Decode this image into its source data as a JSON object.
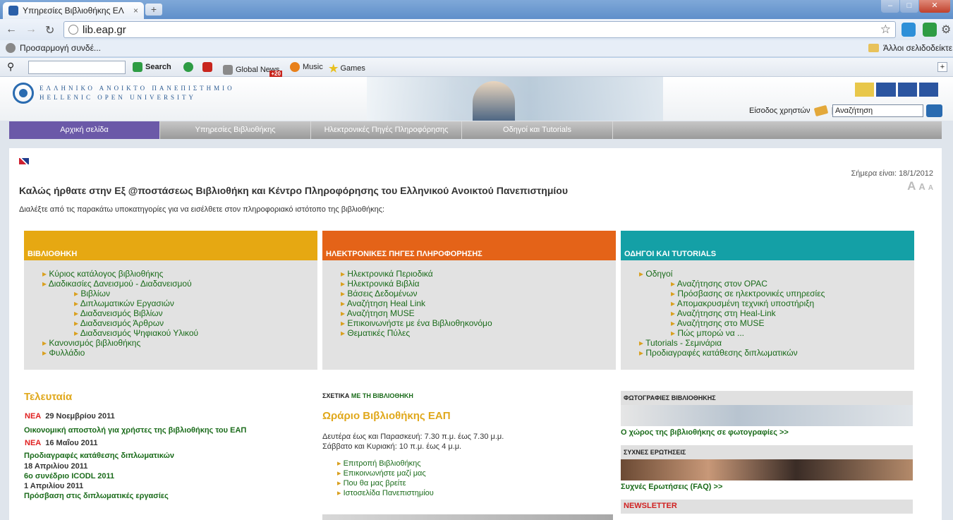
{
  "browser": {
    "tab_title": "Υπηρεσίες Βιβλιοθήκης ΕΛ",
    "url": "lib.eap.gr",
    "bookmark_customize": "Προσαρμογή συνδέ...",
    "bookmark_other": "Άλλοι σελιδοδείκτε",
    "toolbar2": {
      "search_label": "Search",
      "global_news": "Global News",
      "global_news_badge": "+20",
      "music": "Music",
      "games": "Games"
    }
  },
  "header": {
    "logo_line1": "ΕΛΛΗΝΙΚΟ ΑΝΟΙΚΤΟ ΠΑΝΕΠΙΣΤΗΜΙΟ",
    "logo_line2": "HELLENIC OPEN UNIVERSITY",
    "login": "Είσοδος χρηστών",
    "search_value": "Αναζήτηση"
  },
  "menu": [
    "Αρχική σελίδα",
    "Υπηρεσίες Βιβλιοθήκης",
    "Ηλεκτρονικές Πηγές Πληροφόρησης",
    "Οδηγοί και Tutorials"
  ],
  "today": "Σήμερα είναι: 18/1/2012",
  "welcome": "Καλώς ήρθατε στην Εξ @ποστάσεως Βιβλιοθήκη και Κέντρο Πληροφόρησης του Ελληνικού Ανοικτού Πανεπιστημίου",
  "intro": "Διαλέξτε από τις παρακάτω υποκατηγορίες για να εισέλθετε στον πληροφοριακό ιστότοπο της βιβλιοθήκης:",
  "boxes": [
    {
      "title": "ΒΙΒΛΙΟΘΗΚΗ",
      "color": "#e6a812",
      "items": [
        {
          "label": "Κύριος κατάλογος βιβλιοθήκης",
          "level": 1
        },
        {
          "label": "Διαδικασίες Δανεισμού - Διαδανεισμού",
          "level": 1
        },
        {
          "label": "Βιβλίων",
          "level": 2
        },
        {
          "label": "Διπλωματικών Εργασιών",
          "level": 2
        },
        {
          "label": "Διαδανεισμός Βιβλίων",
          "level": 2
        },
        {
          "label": "Διαδανεισμός Άρθρων",
          "level": 2
        },
        {
          "label": "Διαδανεισμός Ψηφιακού Υλικού",
          "level": 2
        },
        {
          "label": "Κανονισμός βιβλιοθήκης",
          "level": 1
        },
        {
          "label": "Φυλλάδιο",
          "level": 1
        }
      ]
    },
    {
      "title": "ΗΛΕΚΤΡΟΝΙΚΕΣ ΠΗΓΕΣ ΠΛΗΡΟΦΟΡΗΣΗΣ",
      "color": "#e46318",
      "items": [
        {
          "label": "Ηλεκτρονικά Περιοδικά",
          "level": 1
        },
        {
          "label": "Ηλεκτρονικά Βιβλία",
          "level": 1
        },
        {
          "label": "Βάσεις Δεδομένων",
          "level": 1
        },
        {
          "label": "Αναζήτηση Heal Link",
          "level": 1
        },
        {
          "label": "Αναζήτηση MUSE",
          "level": 1
        },
        {
          "label": "Επικοινωνήστε με ένα Βιβλιοθηκονόμο",
          "level": 1
        },
        {
          "label": "Θεματικές Πύλες",
          "level": 1
        }
      ]
    },
    {
      "title": "ΟΔΗΓΟΙ ΚΑΙ TUTORIALS",
      "color": "#14a0a6",
      "items": [
        {
          "label": "Οδηγοί",
          "level": 1
        },
        {
          "label": "Αναζήτησης στον OPAC",
          "level": 2
        },
        {
          "label": "Πρόσβασης σε ηλεκτρονικές υπηρεσίες",
          "level": 2
        },
        {
          "label": "Απομακρυσμένη τεχνική υποστήριξη",
          "level": 2
        },
        {
          "label": "Αναζήτησης στη Heal-Link",
          "level": 2
        },
        {
          "label": "Αναζήτησης στο MUSE",
          "level": 2
        },
        {
          "label": "Πώς μπορώ να ...",
          "level": 2
        },
        {
          "label": "Tutorials - Σεμινάρια",
          "level": 1
        },
        {
          "label": "Προδιαγραφές κατάθεσης διπλωματικών",
          "level": 1
        }
      ]
    }
  ],
  "news": {
    "title": "Τελευταία",
    "new_badge": "ΝΕΑ",
    "items": [
      {
        "date": "29 Νοεμβρίου 2011",
        "text": "Οικονομική αποστολή για χρήστες της βιβλιοθήκης του ΕΑΠ"
      },
      {
        "date": "16 Μαΐου 2011",
        "text": "Προδιαγραφές κατάθεσης διπλωματικών"
      },
      {
        "date": "18 Απριλίου 2011",
        "text": "6ο συνέδριο ICODL 2011"
      },
      {
        "date": "1 Απριλίου 2011",
        "text": "Πρόσβαση στις διπλωματικές εργασίες"
      }
    ]
  },
  "about": {
    "label_a": "ΣΧΕΤΙΚΑ",
    "label_b": "ΜΕ ΤΗ ΒΙΒΛΙΟΘΗΚΗ",
    "hours_title": "Ωράριο Βιβλιοθήκης ΕΑΠ",
    "hours_1": "Δευτέρα έως και Παρασκευή: 7.30 π.μ. έως 7.30 μ.μ.",
    "hours_2": "Σάββατο και Κυριακή: 10 π.μ. έως 4 μ.μ.",
    "links": [
      "Επιτροπή Βιβλιοθήκης",
      "Επικοινωνήστε μαζί μας",
      "Που θα μας βρείτε",
      "Ιστοσελίδα Πανεπιστημίου"
    ]
  },
  "side": {
    "photos_title": "ΦΩΤΟΓΡΑΦΙΕΣ ΒΙΒΛΙΟΘΗΚΗΣ",
    "photos_link": "Ο χώρος της βιβλιοθήκης σε φωτογραφίες >>",
    "faq_title": "ΣΥΧΝΕΣ ΕΡΩΤΗΣΕΙΣ",
    "faq_link": "Συχνές Ερωτήσεις (FAQ) >>",
    "newsletter": "NEWSLETTER"
  }
}
